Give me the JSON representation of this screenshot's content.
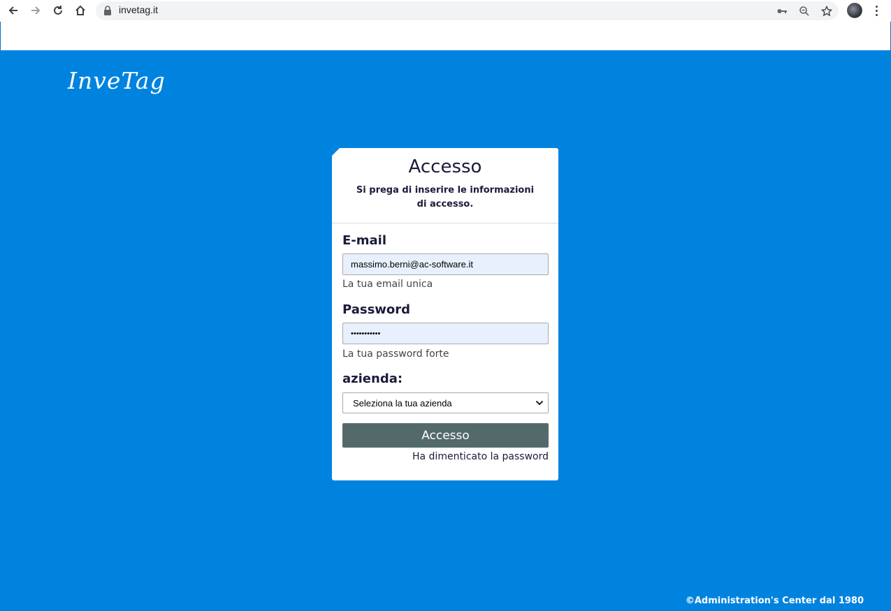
{
  "browser": {
    "url": "invetag.it",
    "icons": [
      "back-arrow-icon",
      "forward-arrow-icon",
      "reload-icon",
      "home-icon",
      "lock-icon",
      "key-icon",
      "zoom-icon",
      "star-icon",
      "avatar",
      "menu-dots-icon"
    ]
  },
  "header": {
    "logo_text": "InveTag"
  },
  "login": {
    "title": "Accesso",
    "subtitle": "Si prega di inserire le informazioni di accesso.",
    "email": {
      "label": "E-mail",
      "value": "massimo.berni@ac-software.it",
      "help": "La tua email unica"
    },
    "password": {
      "label": "Password",
      "value": "•••••••••••",
      "help": "La tua password forte"
    },
    "company": {
      "label": "azienda:",
      "selected": "Seleziona la tua azienda"
    },
    "submit_label": "Accesso",
    "forgot_label": "Ha dimenticato la password"
  },
  "footer": {
    "copyright": "©Administration's Center dal 1980"
  },
  "colors": {
    "page_background": "#0083df",
    "button_background": "#546a6a",
    "autofill_background": "#e8f0fe"
  }
}
